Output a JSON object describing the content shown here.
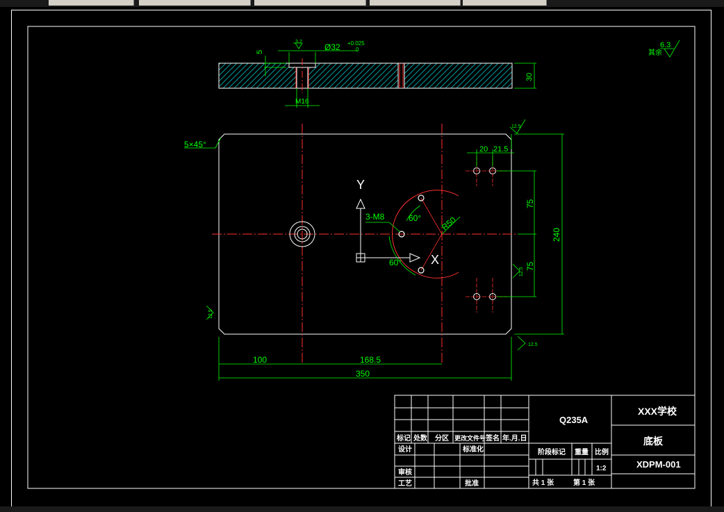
{
  "drawing": {
    "section_dims": {
      "depth": "5",
      "roughness_small": "3.2",
      "bore": "Ø32",
      "tol_upper": "+0.025",
      "tol_lower": "0",
      "thickness": "30",
      "thread": "M16"
    },
    "plan_dims": {
      "chamfer": "5×45°",
      "roughness_corner": "12.5",
      "pitch_a": "20",
      "pitch_b": "21.5",
      "half_height_top": "75",
      "half_height_bottom": "75",
      "height": "240",
      "holes_label": "3-M8",
      "angle_top": "60°",
      "angle_bottom": "60°",
      "radius": "R50",
      "roughness_side": "12.5",
      "roughness_left": "12.5",
      "roughness_bottom": "12.5",
      "offset_left": "100",
      "offset_center": "168.5",
      "width": "350"
    },
    "ucs": {
      "x_label": "X",
      "y_label": "Y"
    },
    "general_roughness": {
      "value": "6.3",
      "label": "其余"
    }
  },
  "title_block": {
    "material": "Q235A",
    "school": "XXX学校",
    "part_name": "底板",
    "drawing_no": "XDPM-001",
    "rev_headers": [
      "标记",
      "处数",
      "分区",
      "更改文件号",
      "签名",
      "年.月.日"
    ],
    "roles": [
      "设计",
      "审核",
      "工艺"
    ],
    "standardize": "标准化",
    "approve": "批准",
    "stage_label": "阶段标记",
    "weight_label": "重量",
    "scale_label": "比例",
    "scale_value": "1:2",
    "sheets": "共 1 张",
    "sheet_no": "第 1 张"
  }
}
